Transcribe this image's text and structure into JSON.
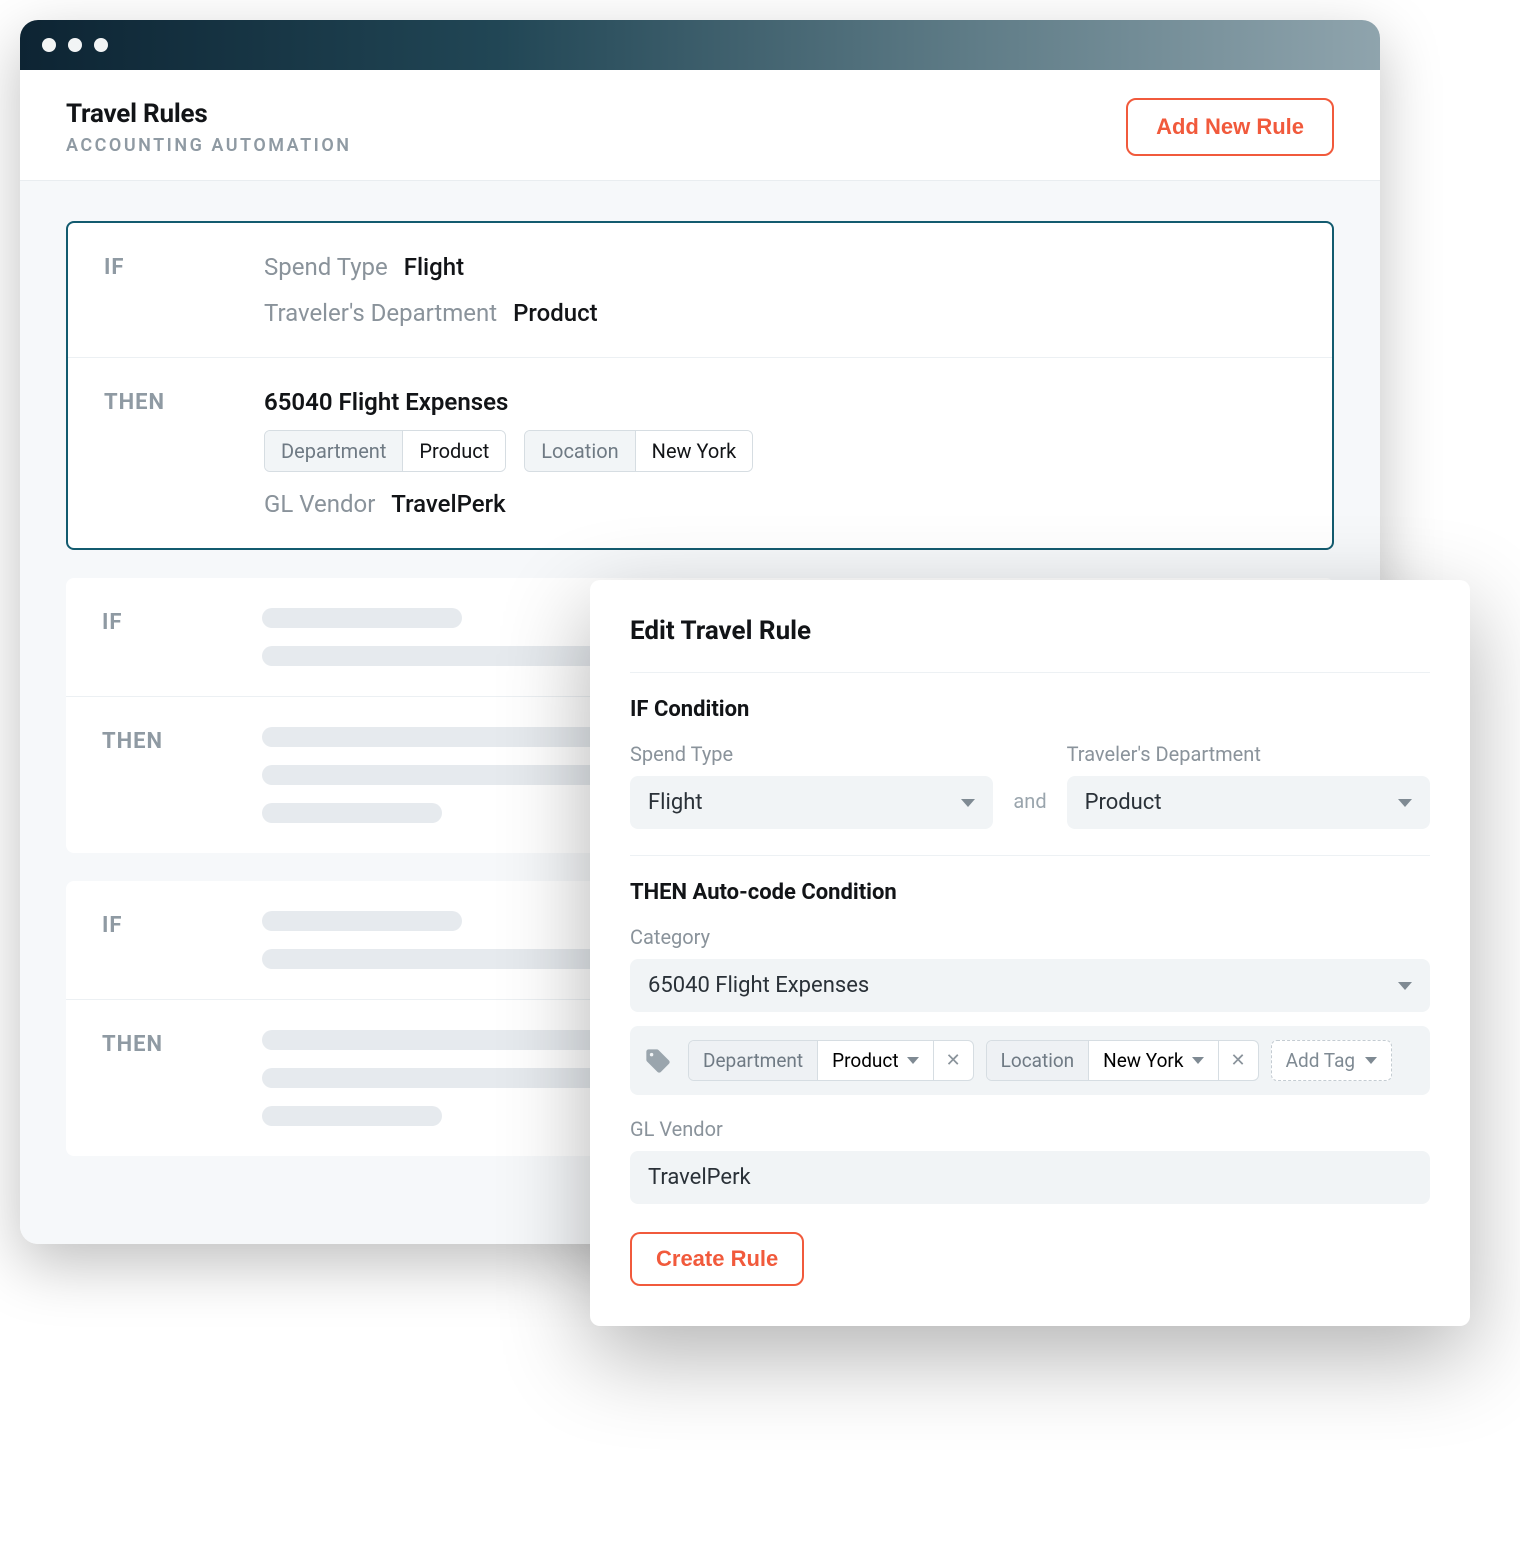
{
  "header": {
    "title": "Travel Rules",
    "subtitle": "ACCOUNTING AUTOMATION",
    "add_button": "Add New Rule"
  },
  "keywords": {
    "if": "IF",
    "then": "THEN"
  },
  "rule1": {
    "if": {
      "spend_type_label": "Spend Type",
      "spend_type_value": "Flight",
      "dept_label": "Traveler's Department",
      "dept_value": "Product"
    },
    "then": {
      "code": "65040 Flight Expenses",
      "tag1_key": "Department",
      "tag1_val": "Product",
      "tag2_key": "Location",
      "tag2_val": "New York",
      "vendor_label": "GL Vendor",
      "vendor_value": "TravelPerk"
    }
  },
  "modal": {
    "title": "Edit Travel Rule",
    "if_heading": "IF Condition",
    "spend_type_label": "Spend Type",
    "spend_type_value": "Flight",
    "and": "and",
    "dept_label": "Traveler's Department",
    "dept_value": "Product",
    "then_heading": "THEN Auto-code Condition",
    "category_label": "Category",
    "category_value": "65040 Flight Expenses",
    "tag1_key": "Department",
    "tag1_val": "Product",
    "tag2_key": "Location",
    "tag2_val": "New York",
    "add_tag": "Add Tag",
    "vendor_label": "GL Vendor",
    "vendor_value": "TravelPerk",
    "create_button": "Create Rule"
  }
}
